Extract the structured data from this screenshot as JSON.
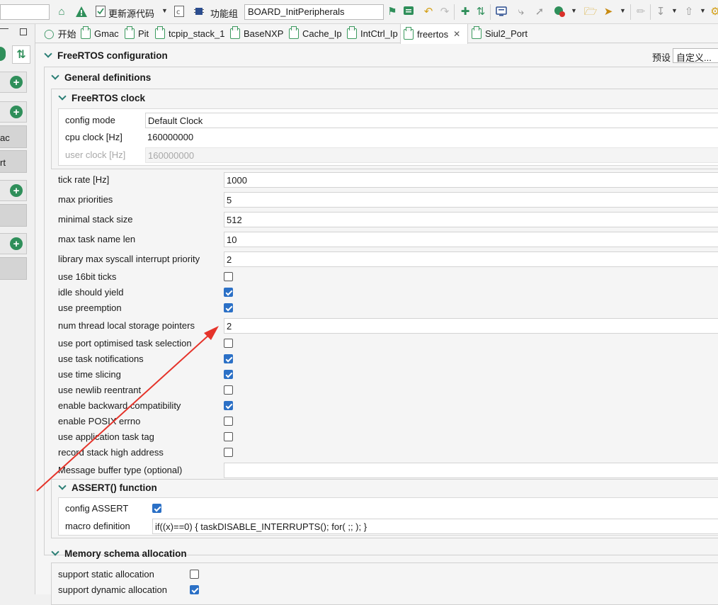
{
  "toolbar": {
    "search_value": "",
    "generate_code_label": "更新源代码",
    "function_group_label": "功能组",
    "function_group_value": "BOARD_InitPeripherals"
  },
  "tabs": [
    {
      "label": "开始",
      "active": false
    },
    {
      "label": "Gmac",
      "active": false
    },
    {
      "label": "Pit",
      "active": false
    },
    {
      "label": "tcpip_stack_1",
      "active": false
    },
    {
      "label": "BaseNXP",
      "active": false
    },
    {
      "label": "Cache_Ip",
      "active": false
    },
    {
      "label": "IntCtrl_Ip",
      "active": false
    },
    {
      "label": "freertos",
      "active": true
    },
    {
      "label": "Siul2_Port",
      "active": false
    }
  ],
  "left_panel": {
    "items": [
      "ac",
      "rt"
    ]
  },
  "config": {
    "title": "FreeRTOS configuration",
    "preset_label": "预设",
    "preset_value": "自定义...",
    "general_title": "General definitions",
    "clock": {
      "title": "FreeRTOS clock",
      "config_mode_label": "config mode",
      "config_mode_value": "Default Clock",
      "cpu_clock_label": "cpu clock [Hz]",
      "cpu_clock_value": "160000000",
      "user_clock_label": "user clock [Hz]",
      "user_clock_value": "160000000"
    },
    "fields": [
      {
        "label": "tick rate [Hz]",
        "value": "1000"
      },
      {
        "label": "max priorities",
        "value": "5"
      },
      {
        "label": "minimal stack size",
        "value": "512"
      },
      {
        "label": "max task name len",
        "value": "10"
      },
      {
        "label": "library max syscall interrupt priority",
        "value": "2"
      }
    ],
    "flags": [
      {
        "label": "use 16bit ticks",
        "checked": false
      },
      {
        "label": "idle should yield",
        "checked": true
      },
      {
        "label": "use preemption",
        "checked": true
      }
    ],
    "tls": {
      "label": "num thread local storage pointers",
      "value": "2"
    },
    "flags2": [
      {
        "label": "use port optimised task selection",
        "checked": false
      },
      {
        "label": "use task notifications",
        "checked": true
      },
      {
        "label": "use time slicing",
        "checked": true
      },
      {
        "label": "use newlib reentrant",
        "checked": false
      },
      {
        "label": "enable backward compatibility",
        "checked": true
      },
      {
        "label": "enable POSIX errno",
        "checked": false
      },
      {
        "label": "use application task tag",
        "checked": false
      },
      {
        "label": "record stack high address",
        "checked": false
      }
    ],
    "msgbuf": {
      "label": "Message buffer type (optional)",
      "value": ""
    },
    "assert": {
      "title": "ASSERT() function",
      "config_label": "config ASSERT",
      "config_checked": true,
      "macro_label": "macro definition",
      "macro_value": "if((x)==0) { taskDISABLE_INTERRUPTS(); for( ;; ); }"
    },
    "memory": {
      "title": "Memory schema allocation",
      "items": [
        {
          "label": "support static allocation",
          "checked": false
        },
        {
          "label": "support dynamic allocation",
          "checked": true
        }
      ]
    }
  },
  "colors": {
    "accent_green": "#2f8f5a",
    "checkbox_blue": "#2b70c6",
    "annotation_red": "#e5332a"
  }
}
